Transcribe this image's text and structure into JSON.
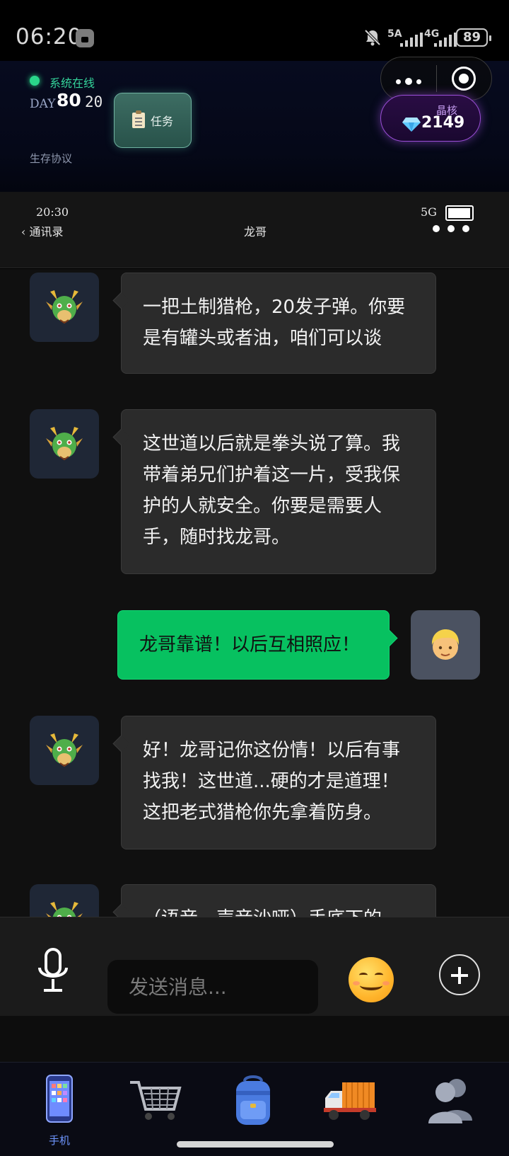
{
  "status_bar": {
    "time": "06:20",
    "net1": "5A",
    "net2": "4G",
    "battery": "89"
  },
  "game_header": {
    "online_status": "系统在线",
    "day_label": "DAY",
    "day_number": "80",
    "hour": "20",
    "task_label": "任务",
    "protocol_label": "生存协议",
    "crystal_label": "晶核",
    "crystal_value": "2149"
  },
  "phone_bar": {
    "time": "20:30",
    "back_label": "通讯录",
    "title": "龙哥",
    "signal": "5G"
  },
  "messages": [
    {
      "sender": "龙哥",
      "side": "left",
      "avatar": "dragon-avatar",
      "text": "一把土制猎枪，20发子弹。你要是有罐头或者油，咱们可以谈"
    },
    {
      "sender": "龙哥",
      "side": "left",
      "avatar": "dragon-avatar",
      "text": "这世道以后就是拳头说了算。我带着弟兄们护着这一片，受我保护的人就安全。你要是需要人手，随时找龙哥。"
    },
    {
      "sender": "me",
      "side": "right",
      "avatar": "blond-person-avatar",
      "text": "龙哥靠谱！以后互相照应！"
    },
    {
      "sender": "龙哥",
      "side": "left",
      "avatar": "dragon-avatar",
      "text": "好！龙哥记你这份情！以后有事找我！这世道...硬的才是道理！这把老式猎枪你先拿着防身。"
    },
    {
      "sender": "龙哥",
      "side": "left",
      "avatar": "dragon-avatar",
      "text": "（语音，声音沙哑）手底下的"
    }
  ],
  "input_bar": {
    "placeholder": "发送消息..."
  },
  "bottom_nav": {
    "items": [
      {
        "label": "手机",
        "icon": "phone-icon",
        "active": true
      },
      {
        "label": "",
        "icon": "shopping-cart-icon",
        "active": false
      },
      {
        "label": "",
        "icon": "backpack-icon",
        "active": false
      },
      {
        "label": "",
        "icon": "delivery-truck-icon",
        "active": false
      },
      {
        "label": "",
        "icon": "people-icon",
        "active": false
      }
    ]
  },
  "colors": {
    "accent_green": "#07c160",
    "online_green": "#2ad68a",
    "crystal_purple": "#9b4ed6",
    "nav_active": "#6f96ff"
  }
}
